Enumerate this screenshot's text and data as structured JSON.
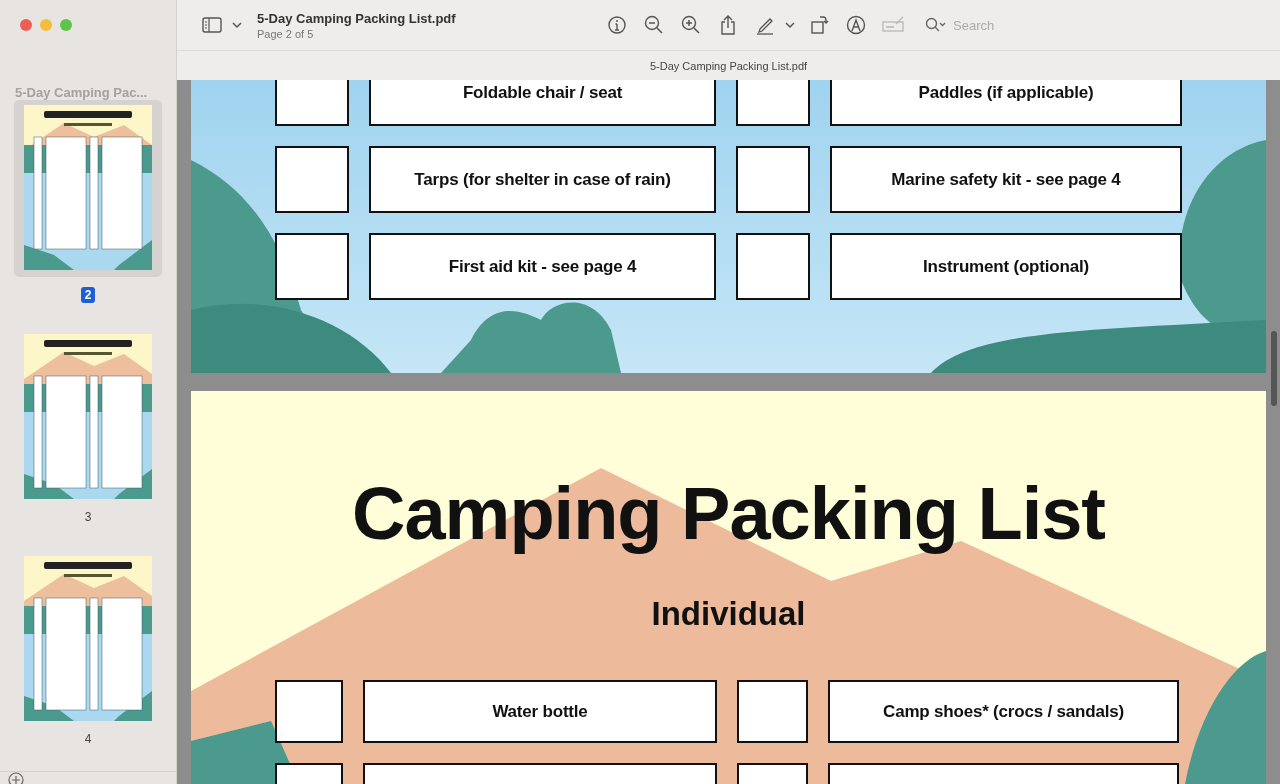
{
  "window": {
    "title": "5-Day Camping Packing List.pdf",
    "subtitle": "Page 2 of 5",
    "document_title": "5-Day Camping Packing List.pdf"
  },
  "toolbar": {
    "buttons": [
      {
        "kind": "sidebar",
        "disabled": false
      },
      {
        "kind": "chevron",
        "disabled": false
      },
      {
        "kind": "info",
        "disabled": false
      },
      {
        "kind": "zoom-out",
        "disabled": false
      },
      {
        "kind": "zoom-in",
        "disabled": false
      },
      {
        "kind": "share",
        "disabled": false
      },
      {
        "kind": "pen",
        "disabled": false
      },
      {
        "kind": "chevron",
        "disabled": false
      },
      {
        "kind": "rotate",
        "disabled": false
      },
      {
        "kind": "markup",
        "disabled": false
      },
      {
        "kind": "form",
        "disabled": true
      }
    ],
    "search": {
      "placeholder": "Search"
    }
  },
  "sidebar": {
    "title": "5-Day Camping Pac...",
    "thumbnails": [
      {
        "label": "2",
        "selected": true
      },
      {
        "label": "3",
        "selected": false
      },
      {
        "label": "4",
        "selected": false
      }
    ]
  },
  "pages": [
    {
      "kind": "list",
      "rows": [
        {
          "left": {
            "label": "Foldable chair / seat",
            "checked": false
          },
          "right": {
            "label": "Paddles (if applicable)",
            "checked": false
          }
        },
        {
          "left": {
            "label": "Tarps (for shelter in case of rain)",
            "checked": false
          },
          "right": {
            "label": "Marine safety kit - see page 4",
            "checked": false
          }
        },
        {
          "left": {
            "label": "First aid kit - see page 4",
            "checked": false
          },
          "right": {
            "label": "Instrument (optional)",
            "checked": false
          }
        }
      ]
    },
    {
      "kind": "titled",
      "title": "Camping Packing List",
      "subtitle": "Individual",
      "rows": [
        {
          "left": {
            "label": "Water bottle",
            "checked": false
          },
          "right": {
            "label": "Camp shoes* (crocs / sandals)",
            "checked": false
          }
        },
        {
          "left": {
            "checked": false
          },
          "right": {
            "checked": false
          }
        }
      ]
    }
  ]
}
